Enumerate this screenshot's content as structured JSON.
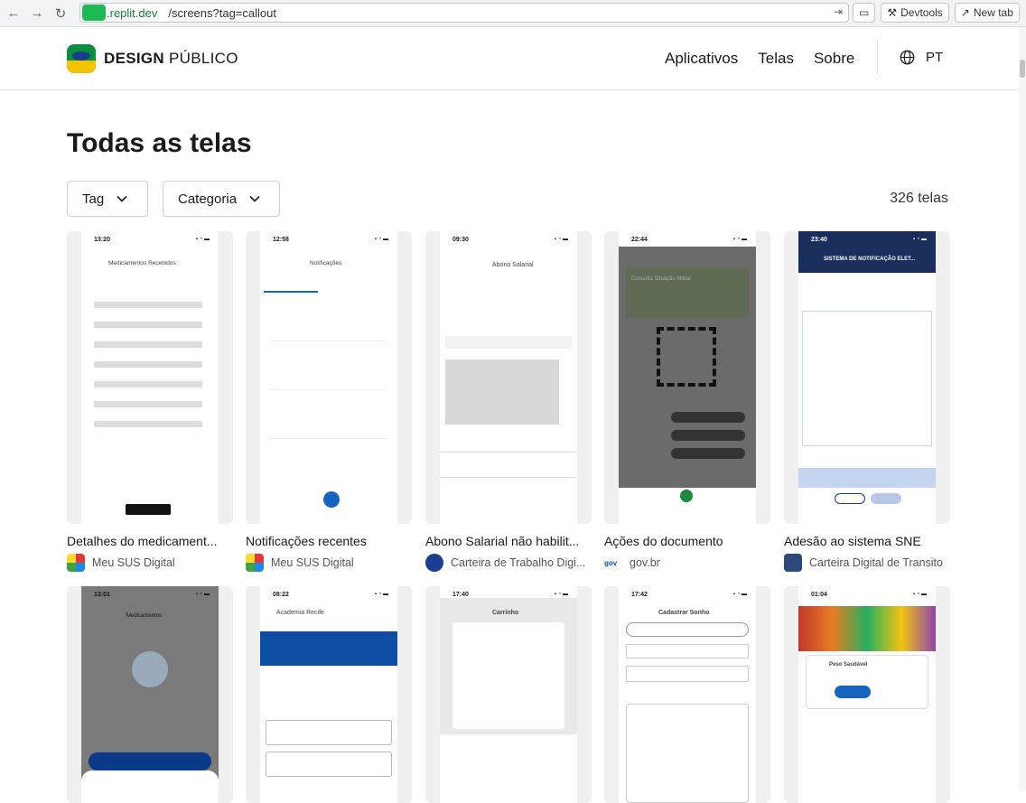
{
  "browser": {
    "url_host": ".replit.dev",
    "url_path": "/screens?tag=callout",
    "devtools_label": "Devtools",
    "newtab_label": "New tab"
  },
  "header": {
    "logo_bold": "DESIGN",
    "logo_rest": "PÚBLICO",
    "nav": [
      "Aplicativos",
      "Telas",
      "Sobre"
    ],
    "lang": "PT"
  },
  "main": {
    "title": "Todas as telas",
    "filter_tag": "Tag",
    "filter_category": "Categoria",
    "count": "326 telas"
  },
  "cards": [
    {
      "title": "Detalhes do medicament...",
      "app": "Meu SUS Digital",
      "time": "13:20",
      "heading": "Medicamentos Recebidos"
    },
    {
      "title": "Notificações recentes",
      "app": "Meu SUS Digital",
      "time": "12:58",
      "heading": "Notificações"
    },
    {
      "title": "Abono Salarial não habilit...",
      "app": "Carteira de Trabalho Digi...",
      "time": "09:30",
      "heading": "Abono Salarial"
    },
    {
      "title": "Ações do documento",
      "app": "gov.br",
      "time": "22:44",
      "heading": "Consulta Situação Militar"
    },
    {
      "title": "Adesão ao sistema SNE",
      "app": "Carteira Digital de Transito",
      "time": "23:40",
      "heading": "SISTEMA DE NOTIFICAÇÃO ELET..."
    },
    {
      "title": "",
      "app": "",
      "time": "13:01",
      "heading": "Medicamentos"
    },
    {
      "title": "",
      "app": "",
      "time": "08:22",
      "heading": "Academia Recife"
    },
    {
      "title": "",
      "app": "",
      "time": "17:40",
      "heading": "Carrinho"
    },
    {
      "title": "",
      "app": "",
      "time": "17:42",
      "heading": "Cadastrar Sonho"
    },
    {
      "title": "",
      "app": "",
      "time": "01:04",
      "heading": "Peso Saudável"
    }
  ],
  "colors": {
    "sus": "#e53935",
    "ctps": "#1a3d8f",
    "govbr": "#1351b4",
    "cdt": "#2b4a7a",
    "accent_blue": "#1565c0"
  }
}
